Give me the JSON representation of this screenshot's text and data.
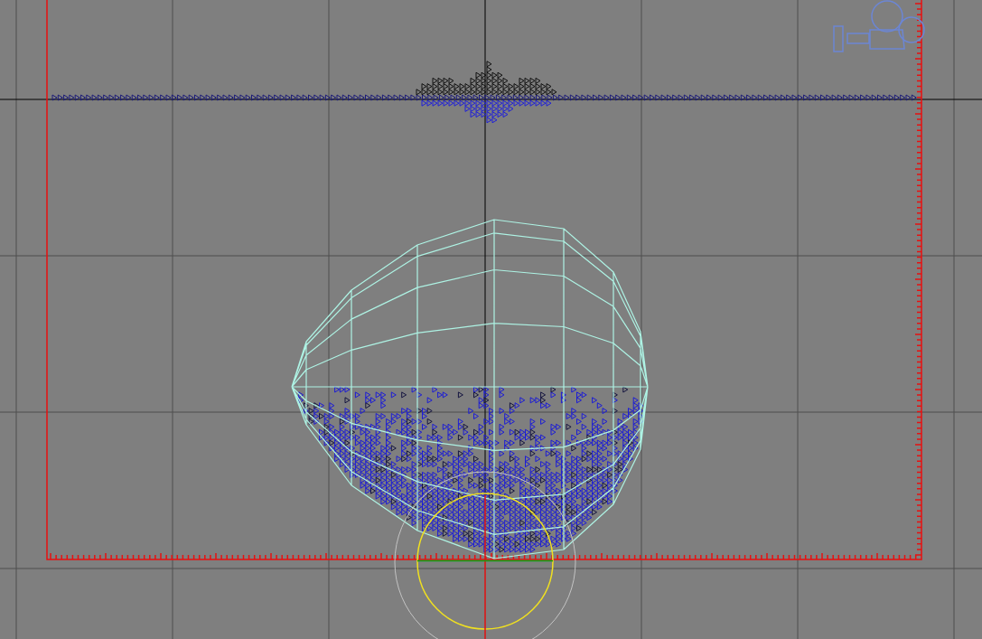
{
  "viewport": {
    "objects": [
      {
        "kind": "render-frame"
      },
      {
        "kind": "particle-stream"
      },
      {
        "kind": "particle-cloud"
      },
      {
        "kind": "bowl"
      },
      {
        "kind": "emitter"
      },
      {
        "kind": "camera"
      }
    ]
  }
}
